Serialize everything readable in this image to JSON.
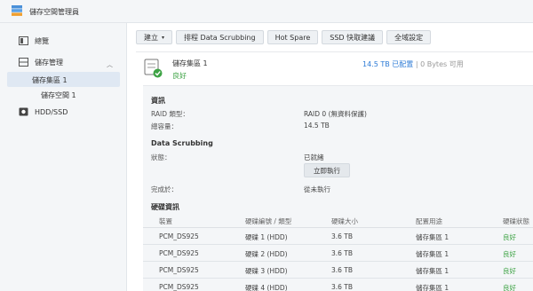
{
  "app": {
    "title": "儲存空間管理員"
  },
  "sidebar": {
    "items": [
      {
        "label": "總覽",
        "icon": "overview-icon"
      },
      {
        "label": "儲存管理",
        "icon": "storage-icon"
      },
      {
        "label": "儲存集區 1"
      },
      {
        "label": "儲存空間 1"
      },
      {
        "label": "HDD/SSD",
        "icon": "disk-icon"
      }
    ]
  },
  "toolbar": {
    "create_label": "建立",
    "schedule_label": "排程 Data Scrubbing",
    "hotspare_label": "Hot Spare",
    "ssd_label": "SSD 快取建議",
    "global_label": "全域設定"
  },
  "pool": {
    "name": "儲存集區 1",
    "status": "良好",
    "used": "14.5 TB 已配置",
    "separator": "|",
    "free": "0 Bytes 可用"
  },
  "info": {
    "title": "資訊",
    "raid_label": "RAID 類型：",
    "raid_value": "RAID 0 (無資料保護)",
    "total_label": "總容量：",
    "total_value": "14.5 TB"
  },
  "scrub": {
    "title": "Data Scrubbing",
    "status_label": "狀態：",
    "status_value": "已就緒",
    "run_label": "立即執行",
    "done_label": "完成於：",
    "done_value": "從未執行"
  },
  "disks": {
    "title": "硬碟資訊",
    "columns": [
      "裝置",
      "硬碟編號 / 類型",
      "硬碟大小",
      "配置用途",
      "硬碟狀態"
    ],
    "rows": [
      [
        "PCM_DS925",
        "硬碟 1 (HDD)",
        "3.6 TB",
        "儲存集區 1",
        "良好"
      ],
      [
        "PCM_DS925",
        "硬碟 2 (HDD)",
        "3.6 TB",
        "儲存集區 1",
        "良好"
      ],
      [
        "PCM_DS925",
        "硬碟 3 (HDD)",
        "3.6 TB",
        "儲存集區 1",
        "良好"
      ],
      [
        "PCM_DS925",
        "硬碟 4 (HDD)",
        "3.6 TB",
        "儲存集區 1",
        "良好"
      ]
    ]
  },
  "colors": {
    "accent": "#2d7bd6",
    "ok": "#3ea345",
    "selected": "#dfe8f3"
  }
}
